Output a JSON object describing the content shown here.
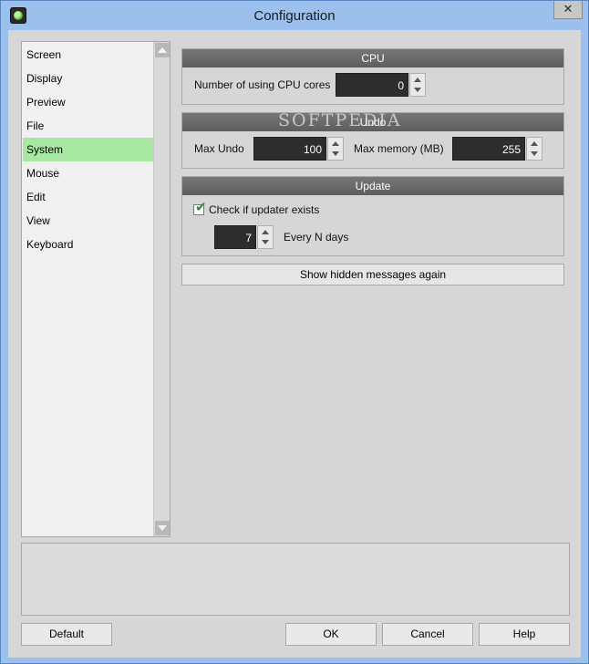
{
  "window": {
    "title": "Configuration",
    "close_glyph": "✕"
  },
  "nav": {
    "items": [
      {
        "label": "Screen"
      },
      {
        "label": "Display"
      },
      {
        "label": "Preview"
      },
      {
        "label": "File"
      },
      {
        "label": "System",
        "selected": true
      },
      {
        "label": "Mouse"
      },
      {
        "label": "Edit"
      },
      {
        "label": "View"
      },
      {
        "label": "Keyboard"
      }
    ]
  },
  "cpu": {
    "header": "CPU",
    "cores_label": "Number of using CPU cores",
    "cores_value": "0"
  },
  "undo": {
    "header": "Undo",
    "max_undo_label": "Max Undo",
    "max_undo_value": "100",
    "max_memory_label": "Max memory (MB)",
    "max_memory_value": "255"
  },
  "update": {
    "header": "Update",
    "check_label": "Check if updater exists",
    "checked": true,
    "days_value": "7",
    "days_label": "Every N days"
  },
  "show_hidden_label": "Show hidden messages again",
  "buttons": {
    "default": "Default",
    "ok": "OK",
    "cancel": "Cancel",
    "help": "Help"
  },
  "watermark": "SOFTPEDIA",
  "colors": {
    "selected_nav": "#a9e8a2",
    "group_header": "#666666",
    "checkmark": "#2b8f2b"
  }
}
